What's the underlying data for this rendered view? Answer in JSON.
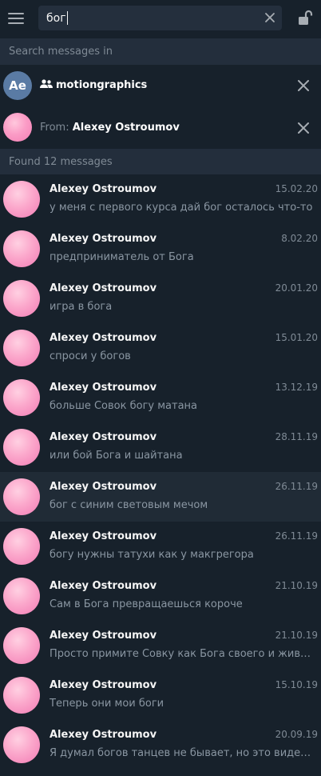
{
  "search": {
    "query": "бог"
  },
  "search_in": {
    "label": "Search messages in"
  },
  "chat_filter": {
    "avatar_text": "Ae",
    "name": "motiongraphics"
  },
  "from_filter": {
    "prefix": "From:",
    "name": "Alexey Ostroumov"
  },
  "results": {
    "label": "Found 12 messages"
  },
  "messages": [
    {
      "name": "Alexey Ostroumov",
      "date": "15.02.20",
      "text": "у меня с первого курса дай бог осталось что-то"
    },
    {
      "name": "Alexey Ostroumov",
      "date": "8.02.20",
      "text": "предприниматель от Бога"
    },
    {
      "name": "Alexey Ostroumov",
      "date": "20.01.20",
      "text": "игра в бога"
    },
    {
      "name": "Alexey Ostroumov",
      "date": "15.01.20",
      "text": "спроси у богов"
    },
    {
      "name": "Alexey Ostroumov",
      "date": "13.12.19",
      "text": "больше Совок богу матана"
    },
    {
      "name": "Alexey Ostroumov",
      "date": "28.11.19",
      "text": "или бой Бога и шайтана"
    },
    {
      "name": "Alexey Ostroumov",
      "date": "26.11.19",
      "text": "бог с синим световым мечом"
    },
    {
      "name": "Alexey Ostroumov",
      "date": "26.11.19",
      "text": "богу нужны татухи как у макгрегора"
    },
    {
      "name": "Alexey Ostroumov",
      "date": "21.10.19",
      "text": "Сам в Бога превращаешься короче"
    },
    {
      "name": "Alexey Ostroumov",
      "date": "21.10.19",
      "text": "Просто примите Совку как Бога своего и живите, м..."
    },
    {
      "name": "Alexey Ostroumov",
      "date": "15.10.19",
      "text": "Теперь они мои боги"
    },
    {
      "name": "Alexey Ostroumov",
      "date": "20.09.19",
      "text": "Я думал богов танцев не бывает, но это видео разру..."
    }
  ]
}
